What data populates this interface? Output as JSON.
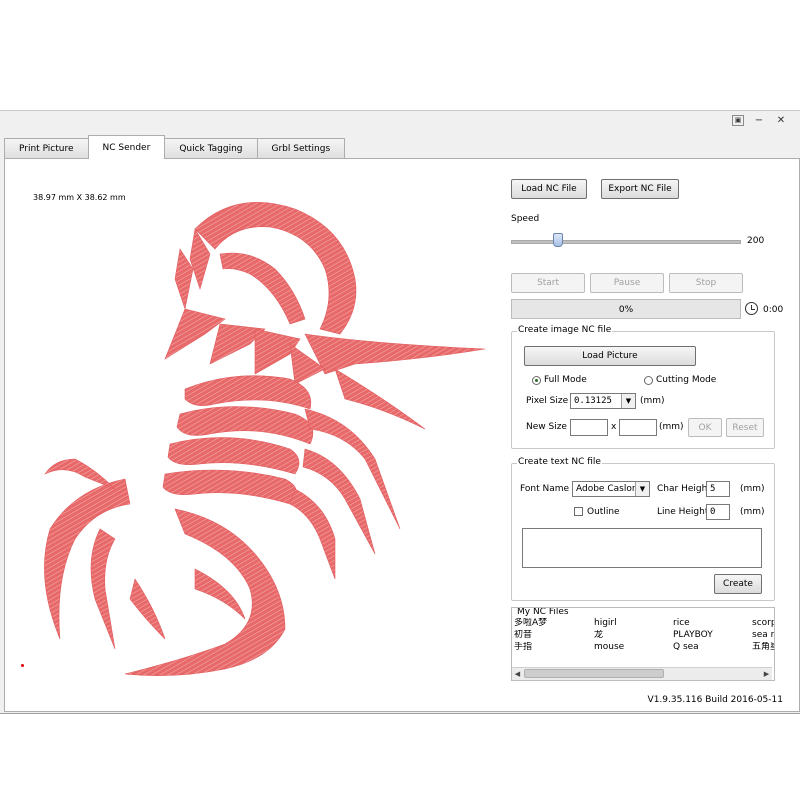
{
  "window": {
    "menu_icon": "▣",
    "minimize_icon": "−",
    "close_icon": "✕"
  },
  "tabs": [
    {
      "label": "Print Picture"
    },
    {
      "label": "NC Sender"
    },
    {
      "label": "Quick Tagging"
    },
    {
      "label": "Grbl Settings"
    }
  ],
  "preview": {
    "dimensions": "38.97 mm X 38.62 mm",
    "image_color": "#e8696a"
  },
  "sender": {
    "load_nc_label": "Load NC File",
    "export_nc_label": "Export NC File",
    "speed_label": "Speed",
    "speed_value": "200",
    "start_label": "Start",
    "pause_label": "Pause",
    "stop_label": "Stop",
    "progress_text": "0%",
    "progress_fraction": 0,
    "elapsed": "0:00"
  },
  "image_nc": {
    "title": "Create image NC file",
    "load_picture_label": "Load Picture",
    "full_mode_label": "Full Mode",
    "cutting_mode_label": "Cutting Mode",
    "pixel_size_label": "Pixel Size",
    "pixel_size_value": "0.13125",
    "pixel_size_unit": "(mm)",
    "new_size_label": "New Size",
    "new_size_x_sep": "x",
    "new_size_unit": "(mm)",
    "ok_label": "OK",
    "reset_label": "Reset"
  },
  "text_nc": {
    "title": "Create text NC file",
    "font_name_label": "Font Name",
    "font_name_value": "Adobe Caslon",
    "char_height_label": "Char Height",
    "char_height_value": "5",
    "char_height_unit": "(mm)",
    "outline_label": "Outline",
    "line_height_label": "Line Height",
    "line_height_value": "0",
    "line_height_unit": "(mm)",
    "create_label": "Create"
  },
  "my_files": {
    "title": "My NC Files",
    "items": [
      "多啦A梦",
      "higirl",
      "rice",
      "scorpi",
      "初音",
      "龙",
      "PLAYBOY",
      "sea ro",
      "手指",
      "mouse",
      "Q sea",
      "五角星"
    ]
  },
  "version": "V1.9.35.116 Build 2016-05-11"
}
